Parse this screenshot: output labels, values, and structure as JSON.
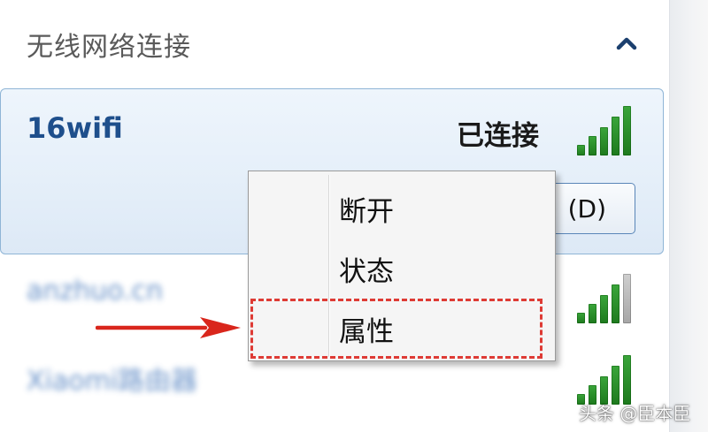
{
  "section": {
    "title": "无线网络连接"
  },
  "connected_network": {
    "name": "16wifi",
    "status": "已连接",
    "action_button": "断开(D)",
    "action_button_visible": "(D)",
    "signal_level": 5
  },
  "other_networks": [
    {
      "name": "anzhuo.cn",
      "signal_level": 4
    },
    {
      "name": "Xiaomi路由器",
      "signal_level": 5
    }
  ],
  "context_menu": {
    "items": [
      {
        "label": "断开"
      },
      {
        "label": "状态"
      },
      {
        "label": "属性"
      }
    ],
    "highlighted_item": "属性"
  },
  "watermark": "头条 @臣本臣",
  "colors": {
    "network_name": "#1e4f8c",
    "signal_on": "#2e8b2e",
    "signal_off": "#b0b0b0",
    "highlight": "#de3b35",
    "arrow": "#d9261c"
  },
  "icons": {
    "collapse": "chevron-up-icon",
    "signal": "wifi-signal-bars-icon",
    "pointer": "red-arrow-right-icon"
  }
}
